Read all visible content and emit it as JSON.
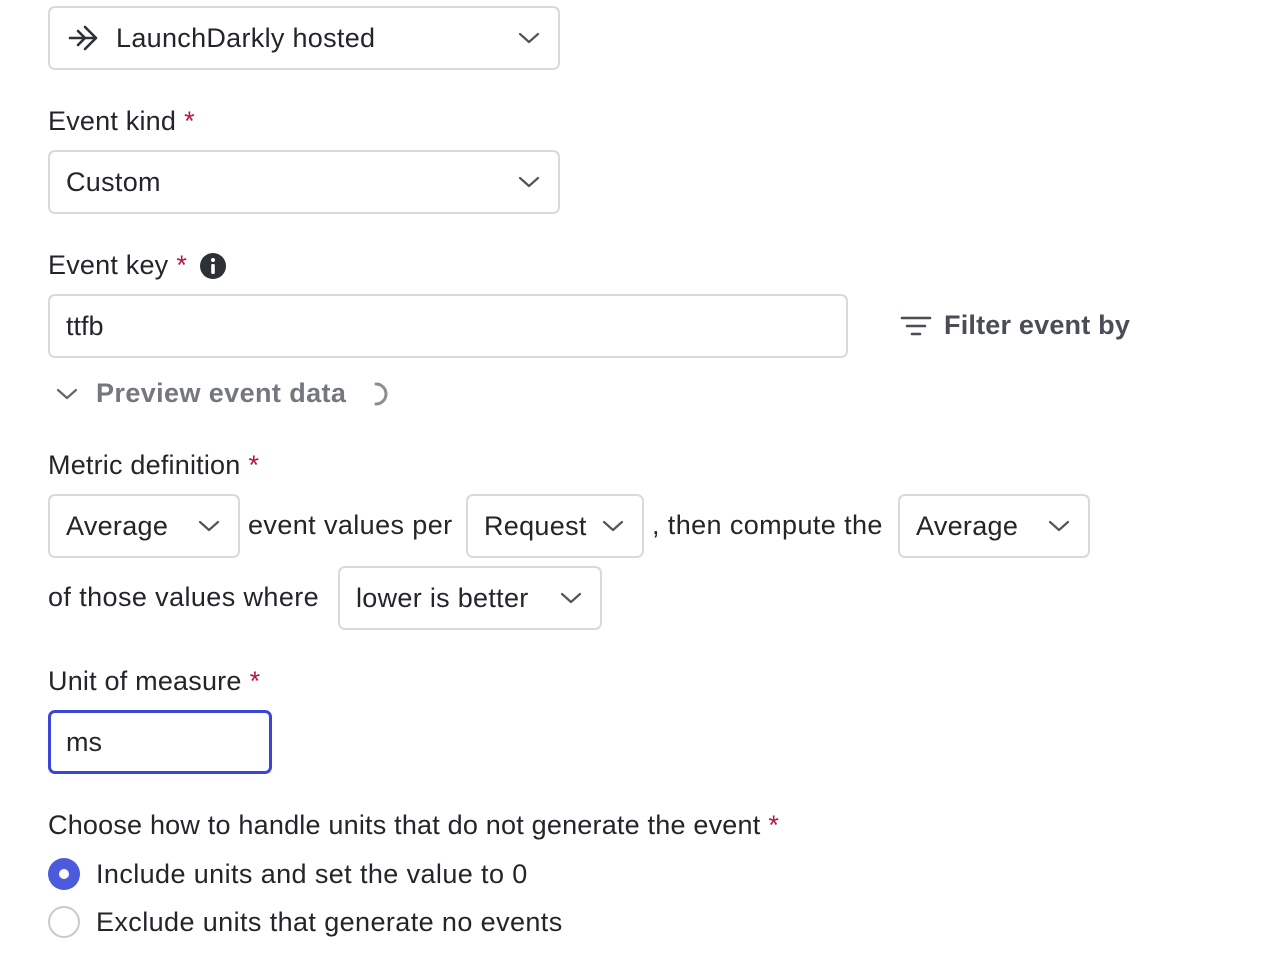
{
  "data_source": {
    "label": "LaunchDarkly hosted",
    "icon": "arrow-right-icon"
  },
  "event_kind": {
    "label": "Event kind",
    "required_mark": "*",
    "value": "Custom"
  },
  "event_key": {
    "label": "Event key",
    "required_mark": "*",
    "value": "ttfb",
    "info_icon": "info-icon"
  },
  "filter": {
    "label": "Filter event by",
    "icon": "filter-icon"
  },
  "preview": {
    "label": "Preview event data"
  },
  "metric_definition": {
    "label": "Metric definition",
    "required_mark": "*",
    "aggregation": "Average",
    "text_per": "event values per",
    "unit": "Request",
    "text_compute": ", then compute the",
    "analysis": "Average",
    "text_where": "of those values where",
    "success": "lower is better"
  },
  "unit_of_measure": {
    "label": "Unit of measure",
    "required_mark": "*",
    "value": "ms"
  },
  "missing_units": {
    "label": "Choose how to handle units that do not generate the event",
    "required_mark": "*",
    "options": [
      {
        "label": "Include units and set the value to 0",
        "selected": true
      },
      {
        "label": "Exclude units that generate no events",
        "selected": false
      }
    ]
  },
  "colors": {
    "required": "#b5154b",
    "accent": "#4b5bdc",
    "focus": "#3c46d6"
  }
}
